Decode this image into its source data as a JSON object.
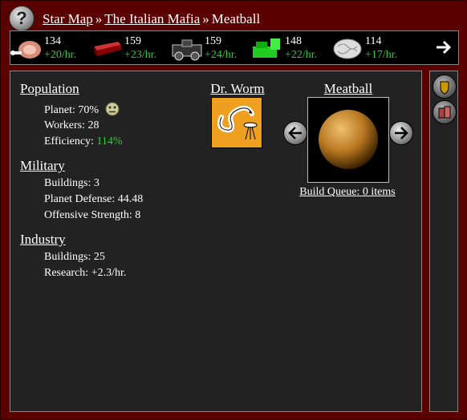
{
  "breadcrumb": {
    "items": [
      {
        "label": "Star Map",
        "link": true
      },
      {
        "label": "The Italian Mafia",
        "link": true
      },
      {
        "label": "Meatball",
        "link": false
      }
    ],
    "separator": "»"
  },
  "resources": [
    {
      "icon": "meat-icon",
      "amount": "134",
      "rate": "+20/hr."
    },
    {
      "icon": "metal-ingot-icon",
      "amount": "159",
      "rate": "+23/hr."
    },
    {
      "icon": "machine-parts-icon",
      "amount": "159",
      "rate": "+24/hr."
    },
    {
      "icon": "crystal-icon",
      "amount": "148",
      "rate": "+22/hr."
    },
    {
      "icon": "brain-icon",
      "amount": "114",
      "rate": "+17/hr."
    }
  ],
  "population": {
    "heading": "Population",
    "planet_label": "Planet: 70%",
    "workers_label": "Workers: 28",
    "efficiency_label": "Efficiency:",
    "efficiency_value": "114%"
  },
  "military": {
    "heading": "Military",
    "buildings": "Buildings: 3",
    "defense": "Planet Defense: 44.48",
    "offense": "Offensive Strength: 8"
  },
  "industry": {
    "heading": "Industry",
    "buildings": "Buildings: 25",
    "research": "Research: +2.3/hr."
  },
  "leader": {
    "name": "Dr. Worm"
  },
  "planet": {
    "name": "Meatball",
    "build_queue": "Build Queue: 0 items"
  },
  "colors": {
    "background": "#5a0000",
    "panel": "#222222",
    "positive": "#33cc33",
    "portrait_bg": "#f0a020"
  }
}
